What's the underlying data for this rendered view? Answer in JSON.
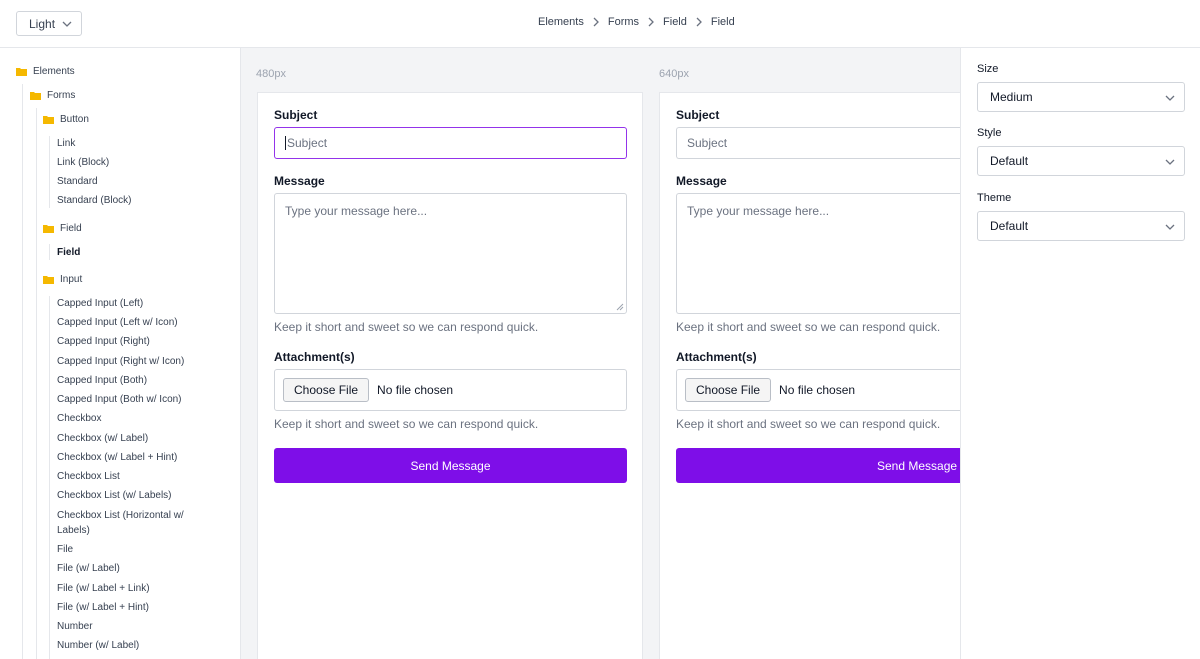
{
  "topbar": {
    "theme_value": "Light",
    "breadcrumb": [
      "Elements",
      "Forms",
      "Field",
      "Field"
    ]
  },
  "sidebar": {
    "root": "Elements",
    "forms": "Forms",
    "button_group": "Button",
    "button_items": [
      "Link",
      "Link (Block)",
      "Standard",
      "Standard (Block)"
    ],
    "field_group": "Field",
    "field_items": [
      "Field"
    ],
    "input_group": "Input",
    "input_items": [
      "Capped Input (Left)",
      "Capped Input (Left w/ Icon)",
      "Capped Input (Right)",
      "Capped Input (Right w/ Icon)",
      "Capped Input (Both)",
      "Capped Input (Both w/ Icon)",
      "Checkbox",
      "Checkbox (w/ Label)",
      "Checkbox (w/ Label + Hint)",
      "Checkbox List",
      "Checkbox List (w/ Labels)",
      "Checkbox List (Horizontal w/",
      "Labels)",
      "File",
      "File (w/ Label)",
      "File (w/ Label + Link)",
      "File (w/ Label + Hint)",
      "Number",
      "Number (w/ Label)"
    ]
  },
  "previews": [
    {
      "size_label": "480px",
      "subject_label": "Subject",
      "subject_placeholder": "Subject",
      "message_label": "Message",
      "message_placeholder": "Type your message here...",
      "message_hint": "Keep it short and sweet so we can respond quick.",
      "attachment_label": "Attachment(s)",
      "choose_file": "Choose File",
      "no_file": "No file chosen",
      "attachment_hint": "Keep it short and sweet so we can respond quick.",
      "send_label": "Send Message"
    },
    {
      "size_label": "640px",
      "subject_label": "Subject",
      "subject_placeholder": "Subject",
      "message_label": "Message",
      "message_placeholder": "Type your message here...",
      "message_hint": "Keep it short and sweet so we can respond quick.",
      "attachment_label": "Attachment(s)",
      "choose_file": "Choose File",
      "no_file": "No file chosen",
      "attachment_hint": "Keep it short and sweet so we can respond quick.",
      "send_label": "Send Message"
    }
  ],
  "controls": {
    "size_label": "Size",
    "size_value": "Medium",
    "style_label": "Style",
    "style_value": "Default",
    "theme_label": "Theme",
    "theme_value": "Default"
  },
  "colors": {
    "accent": "#7e0ee8",
    "focus_border": "#9333ea",
    "folder": "#f5b800"
  }
}
